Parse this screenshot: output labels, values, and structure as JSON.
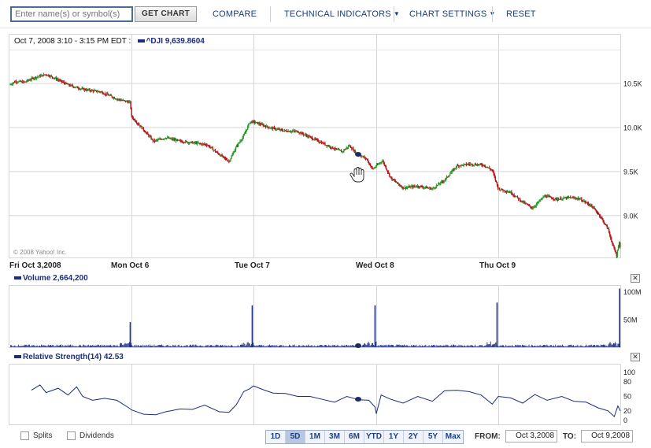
{
  "toolbar": {
    "symbol_placeholder": "Enter name(s) or symbol(s)",
    "get_chart": "GET CHART",
    "compare": "COMPARE",
    "technical_indicators": "TECHNICAL INDICATORS",
    "chart_settings": "CHART SETTINGS",
    "reset": "RESET"
  },
  "price_panel": {
    "period": "Oct 7, 2008 3:10 - 3:15 PM EDT :",
    "symbol": "^DJI",
    "value": "9,639.8604",
    "copyright": "© 2008 Yahoo! Inc."
  },
  "volume_panel": {
    "label": "Volume",
    "value": "2,664,200"
  },
  "rsi_panel": {
    "label": "Relative Strength(14)",
    "value": "42.53"
  },
  "bottom": {
    "splits": "Splits",
    "dividends": "Dividends",
    "ranges": [
      "1D",
      "5D",
      "1M",
      "3M",
      "6M",
      "YTD",
      "1Y",
      "2Y",
      "5Y",
      "Max"
    ],
    "active_range": "5D",
    "from_label": "FROM:",
    "from_value": "Oct 3,2008",
    "to_label": "TO:",
    "to_value": "Oct 9,2008"
  },
  "colors": {
    "up": "#2a9a2a",
    "down": "#b0181a",
    "line": "#1b2d80",
    "grid": "#d6d6d6"
  },
  "chart_data": [
    {
      "type": "line",
      "name": "price",
      "series": [
        {
          "name": "^DJI",
          "points": [
            [
              0,
              10480
            ],
            [
              0.05,
              10520
            ],
            [
              0.12,
              10510
            ],
            [
              0.2,
              10560
            ],
            [
              0.3,
              10600
            ],
            [
              0.38,
              10550
            ],
            [
              0.48,
              10480
            ],
            [
              0.6,
              10430
            ],
            [
              0.75,
              10400
            ],
            [
              0.88,
              10320
            ],
            [
              0.99,
              10280
            ],
            [
              1.0,
              10120
            ],
            [
              1.08,
              10000
            ],
            [
              1.18,
              9840
            ],
            [
              1.28,
              9880
            ],
            [
              1.4,
              9840
            ],
            [
              1.52,
              9820
            ],
            [
              1.62,
              9800
            ],
            [
              1.72,
              9690
            ],
            [
              1.8,
              9610
            ],
            [
              1.86,
              9780
            ],
            [
              1.92,
              9900
            ],
            [
              1.97,
              10060
            ],
            [
              2.0,
              10060
            ],
            [
              2.12,
              10000
            ],
            [
              2.24,
              9960
            ],
            [
              2.36,
              9950
            ],
            [
              2.5,
              9860
            ],
            [
              2.62,
              9780
            ],
            [
              2.72,
              9720
            ],
            [
              2.78,
              9790
            ],
            [
              2.84,
              9700
            ],
            [
              2.92,
              9640
            ],
            [
              2.97,
              9520
            ],
            [
              3.0,
              9560
            ],
            [
              3.05,
              9620
            ],
            [
              3.12,
              9420
            ],
            [
              3.22,
              9310
            ],
            [
              3.34,
              9330
            ],
            [
              3.46,
              9300
            ],
            [
              3.56,
              9400
            ],
            [
              3.66,
              9560
            ],
            [
              3.76,
              9580
            ],
            [
              3.88,
              9570
            ],
            [
              3.95,
              9510
            ],
            [
              4.0,
              9300
            ],
            [
              4.1,
              9260
            ],
            [
              4.2,
              9150
            ],
            [
              4.28,
              9080
            ],
            [
              4.38,
              9220
            ],
            [
              4.48,
              9180
            ],
            [
              4.58,
              9200
            ],
            [
              4.66,
              9190
            ],
            [
              4.76,
              9110
            ],
            [
              4.83,
              9000
            ],
            [
              4.9,
              8840
            ],
            [
              4.94,
              8650
            ],
            [
              4.97,
              8540
            ],
            [
              4.99,
              8700
            ],
            [
              5.0,
              8620
            ]
          ]
        }
      ],
      "x_labels": [
        "Fri Oct 3,2008",
        "Mon Oct 6",
        "Tue Oct 7",
        "Wed Oct 8",
        "Thu Oct 9"
      ],
      "y_ticks": [
        9000,
        9500,
        10000,
        10500
      ],
      "y_tick_labels": [
        "9.0K",
        "9.5K",
        "10.0K",
        "10.5K"
      ],
      "ylim": [
        8520,
        11050
      ]
    },
    {
      "type": "bar",
      "name": "volume",
      "spikes": [
        [
          0.99,
          45
        ],
        [
          1.99,
          75
        ],
        [
          2.99,
          75
        ],
        [
          3.99,
          80
        ],
        [
          4.995,
          105
        ]
      ],
      "baseline_millions": 3,
      "y_ticks": [
        50,
        100
      ],
      "y_tick_labels": [
        "50M",
        "100M"
      ],
      "ylim": [
        0,
        110
      ]
    },
    {
      "type": "line",
      "name": "rsi",
      "series": [
        {
          "name": "RSI(14)",
          "points": [
            [
              0.18,
              65
            ],
            [
              0.25,
              72
            ],
            [
              0.3,
              60
            ],
            [
              0.4,
              65
            ],
            [
              0.48,
              55
            ],
            [
              0.55,
              68
            ],
            [
              0.6,
              52
            ],
            [
              0.68,
              40
            ],
            [
              0.78,
              48
            ],
            [
              0.88,
              40
            ],
            [
              0.98,
              28
            ],
            [
              1.0,
              20
            ],
            [
              1.1,
              15
            ],
            [
              1.2,
              10
            ],
            [
              1.28,
              20
            ],
            [
              1.4,
              22
            ],
            [
              1.5,
              25
            ],
            [
              1.6,
              30
            ],
            [
              1.72,
              20
            ],
            [
              1.8,
              15
            ],
            [
              1.86,
              35
            ],
            [
              1.92,
              58
            ],
            [
              1.97,
              68
            ],
            [
              2.0,
              70
            ],
            [
              2.08,
              66
            ],
            [
              2.16,
              55
            ],
            [
              2.26,
              58
            ],
            [
              2.36,
              48
            ],
            [
              2.46,
              52
            ],
            [
              2.56,
              42
            ],
            [
              2.66,
              40
            ],
            [
              2.76,
              48
            ],
            [
              2.86,
              45
            ],
            [
              2.94,
              40
            ],
            [
              2.99,
              30
            ],
            [
              3.0,
              12
            ],
            [
              3.04,
              55
            ],
            [
              3.12,
              42
            ],
            [
              3.22,
              38
            ],
            [
              3.34,
              48
            ],
            [
              3.46,
              42
            ],
            [
              3.56,
              60
            ],
            [
              3.66,
              65
            ],
            [
              3.76,
              58
            ],
            [
              3.86,
              55
            ],
            [
              3.95,
              32
            ],
            [
              4.0,
              52
            ],
            [
              4.1,
              45
            ],
            [
              4.2,
              38
            ],
            [
              4.3,
              52
            ],
            [
              4.4,
              44
            ],
            [
              4.52,
              48
            ],
            [
              4.62,
              42
            ],
            [
              4.72,
              36
            ],
            [
              4.82,
              28
            ],
            [
              4.9,
              18
            ],
            [
              4.95,
              10
            ],
            [
              4.98,
              28
            ],
            [
              5.0,
              22
            ]
          ]
        }
      ],
      "y_ticks": [
        0,
        20,
        50,
        80,
        100
      ],
      "ylim": [
        0,
        100
      ]
    }
  ]
}
